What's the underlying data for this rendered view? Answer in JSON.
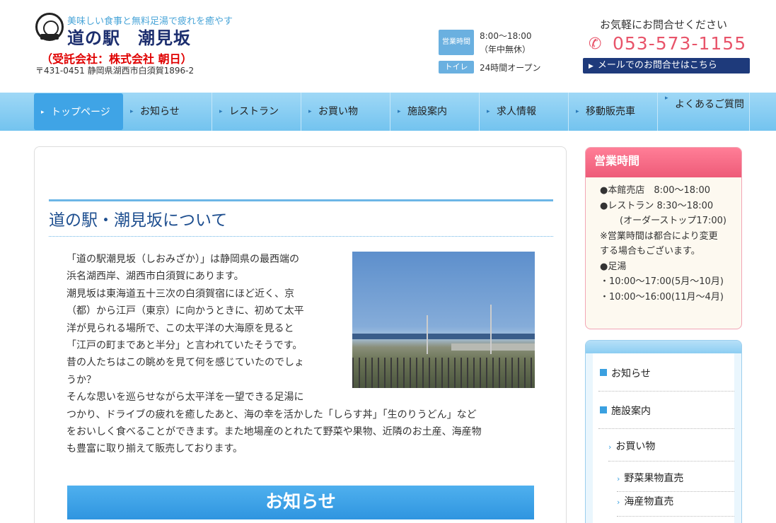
{
  "header": {
    "tagline": "美味しい食事と無料足湯で疲れを癒やす",
    "site_title": "道の駅　潮見坂",
    "company": "（受託会社：株式会社 朝日）",
    "address": "〒431-0451 静岡県湖西市白須賀1896-2",
    "hours_badge": "営業時間",
    "hours_line1": "8:00〜18:00",
    "hours_line2": "（年中無休）",
    "toilet_badge": "トイレ",
    "toilet_text": "24時間オープン",
    "contact_prompt": "お気軽にお問合せください",
    "phone": "053-573-1155",
    "mail_button": "メールでのお問合せはこちら"
  },
  "nav": {
    "items": [
      {
        "label": "トップページ"
      },
      {
        "label": "お知らせ"
      },
      {
        "label": "レストラン"
      },
      {
        "label": "お買い物"
      },
      {
        "label": "施設案内"
      },
      {
        "label": "求人情報"
      },
      {
        "label": "移動販売車"
      },
      {
        "label": "よくあるご質問"
      }
    ]
  },
  "main": {
    "about_title": "道の駅・潮見坂について",
    "about_lines": [
      "「道の駅潮見坂（しおみざか）」は静岡県の最西端の",
      "浜名湖西岸、湖西市白須賀にあります。",
      "潮見坂は東海道五十三次の白須賀宿にほど近く、京",
      "（都）から江戸（東京）に向かうときに、初めて太平",
      "洋が見られる場所で、この太平洋の大海原を見ると",
      "「江戸の町まであと半分」と言われていたそうです。",
      "昔の人たちはこの眺めを見て何を感じていたのでしょ",
      "うか？",
      "そんな思いを巡らせながら太平洋を一望できる足湯に",
      "つかり、ドライブの疲れを癒したあと、海の幸を活かした「しらす丼」「生のりうどん」など",
      "をおいしく食べることができます。また地場産のとれたて野菜や果物、近隣のお土産、海産物",
      "も豊富に取り揃えて販売しております。"
    ],
    "news_heading": "お知らせ"
  },
  "sidebar": {
    "hours_heading": "営業時間",
    "hours_lines": [
      "●本館売店　8:00〜18:00",
      "●レストラン 8:30〜18:00",
      "(オーダーストップ17:00)",
      "※営業時間は都合により変更",
      "する場合もございます。",
      "●足湯",
      "・10:00〜17:00(5月〜10月)",
      "・10:00〜16:00(11月〜4月)"
    ],
    "menu": {
      "news": "お知らせ",
      "facilities": "施設案内",
      "shopping": "お買い物",
      "produce": "野菜果物直売",
      "seafood": "海産物直売"
    }
  }
}
